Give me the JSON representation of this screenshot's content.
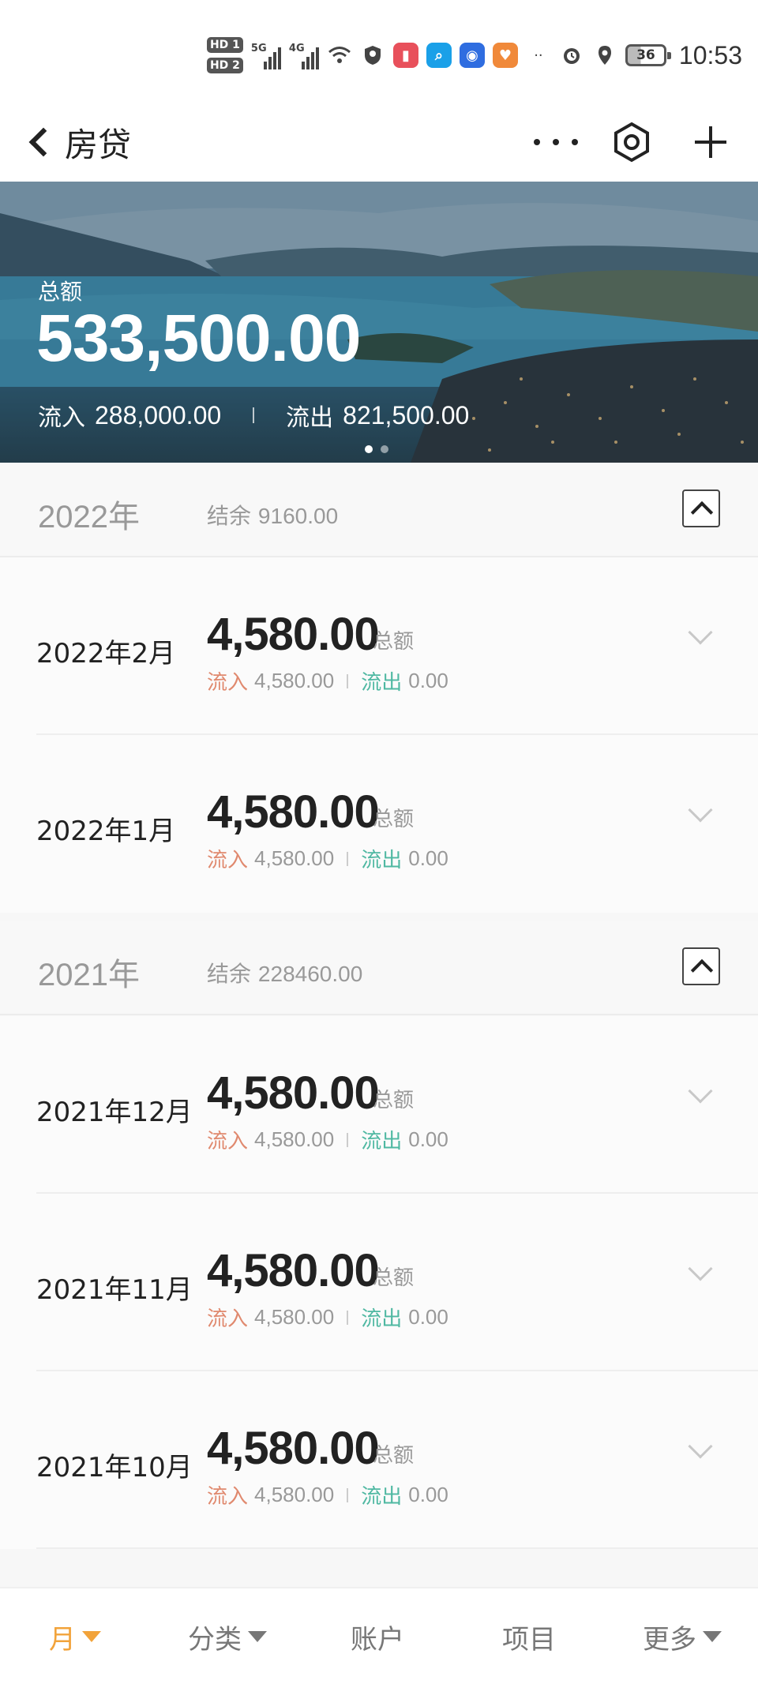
{
  "status_bar": {
    "hd1": "HD 1",
    "hd2": "HD 2",
    "sig1_gen": "5G",
    "sig2_gen": "4G",
    "battery": "36",
    "time": "10:53"
  },
  "nav": {
    "title": "房贷"
  },
  "banner": {
    "total_label": "总额",
    "total_value": "533,500.00",
    "inflow_label": "流入",
    "inflow_value": "288,000.00",
    "outflow_label": "流出",
    "outflow_value": "821,500.00"
  },
  "year_2022": {
    "year": "2022年",
    "balance_label": "结余",
    "balance_value": "9160.00",
    "months": [
      {
        "label": "2022年2月",
        "amount": "4,580.00",
        "amount_label": "总额",
        "in_label": "流入",
        "in_value": "4,580.00",
        "out_label": "流出",
        "out_value": "0.00"
      },
      {
        "label": "2022年1月",
        "amount": "4,580.00",
        "amount_label": "总额",
        "in_label": "流入",
        "in_value": "4,580.00",
        "out_label": "流出",
        "out_value": "0.00"
      }
    ]
  },
  "year_2021": {
    "year": "2021年",
    "balance_label": "结余",
    "balance_value": "228460.00",
    "months": [
      {
        "label": "2021年12月",
        "amount": "4,580.00",
        "amount_label": "总额",
        "in_label": "流入",
        "in_value": "4,580.00",
        "out_label": "流出",
        "out_value": "0.00"
      },
      {
        "label": "2021年11月",
        "amount": "4,580.00",
        "amount_label": "总额",
        "in_label": "流入",
        "in_value": "4,580.00",
        "out_label": "流出",
        "out_value": "0.00"
      },
      {
        "label": "2021年10月",
        "amount": "4,580.00",
        "amount_label": "总额",
        "in_label": "流入",
        "in_value": "4,580.00",
        "out_label": "流出",
        "out_value": "0.00"
      }
    ]
  },
  "tabs": {
    "month": "月",
    "category": "分类",
    "account": "账户",
    "project": "项目",
    "more": "更多"
  },
  "colors": {
    "accent": "#f2a33a",
    "inflow": "#e0896e",
    "outflow": "#4fb8a2"
  }
}
